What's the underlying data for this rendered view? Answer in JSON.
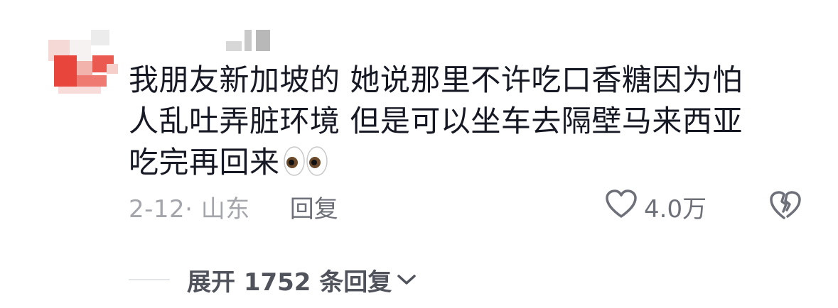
{
  "comment": {
    "content_lines": [
      "我朋友新加坡的 她说那里不许吃口香糖因为怕",
      "人乱吐弄脏环境 但是可以坐车去隔壁马来西亚",
      "吃完再回来"
    ],
    "emoji": "eyes-emoji",
    "date_location": "2-12· 山东",
    "reply_label": "回复",
    "like_count": "4.0万",
    "expand_label": "展开 1752 条回复"
  },
  "colors": {
    "text_primary": "#161823",
    "text_secondary": "#a3a5ab",
    "text_action": "#6e7079",
    "expand_text": "#51535c",
    "avatar_red": "#e8453c"
  },
  "icons": {
    "like": "heart-outline-icon",
    "dislike": "broken-heart-icon",
    "expand": "chevron-down-icon"
  }
}
